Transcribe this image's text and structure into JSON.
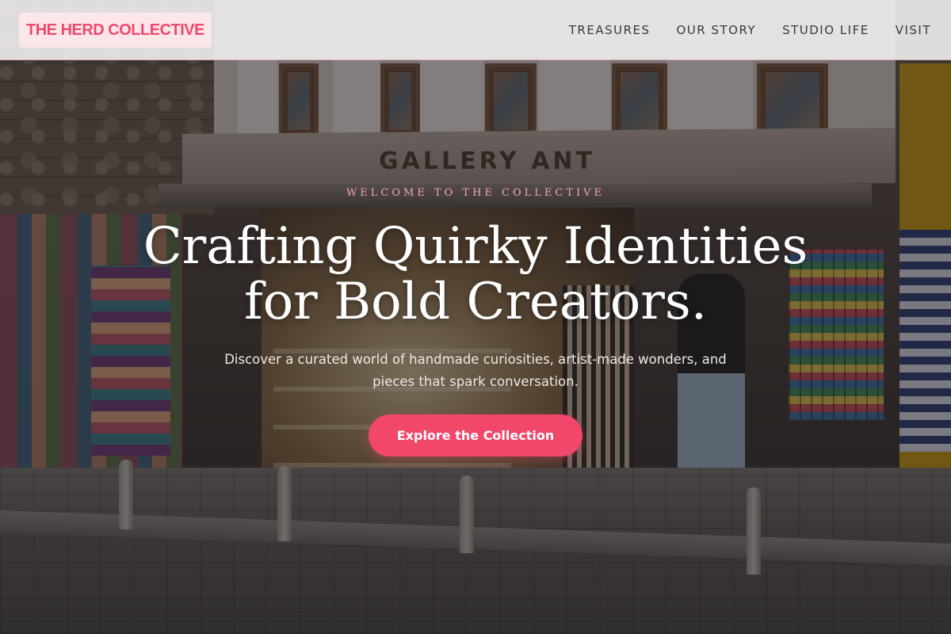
{
  "brand": {
    "logo_text": "THE HERD COLLECTIVE",
    "accent_color": "#f0476b"
  },
  "nav": {
    "items": [
      {
        "label": "TREASURES"
      },
      {
        "label": "OUR STORY"
      },
      {
        "label": "STUDIO LIFE"
      },
      {
        "label": "VISIT"
      }
    ]
  },
  "hero": {
    "background_sign_text": "GALLERY ANT",
    "eyebrow": "WELCOME TO THE COLLECTIVE",
    "headline_line1": "Crafting Quirky Identities",
    "headline_line2": "for Bold Creators.",
    "subtext": "Discover a curated world of handmade curiosities, artist-made wonders, and pieces that spark conversation.",
    "cta_label": "Explore the Collection"
  }
}
